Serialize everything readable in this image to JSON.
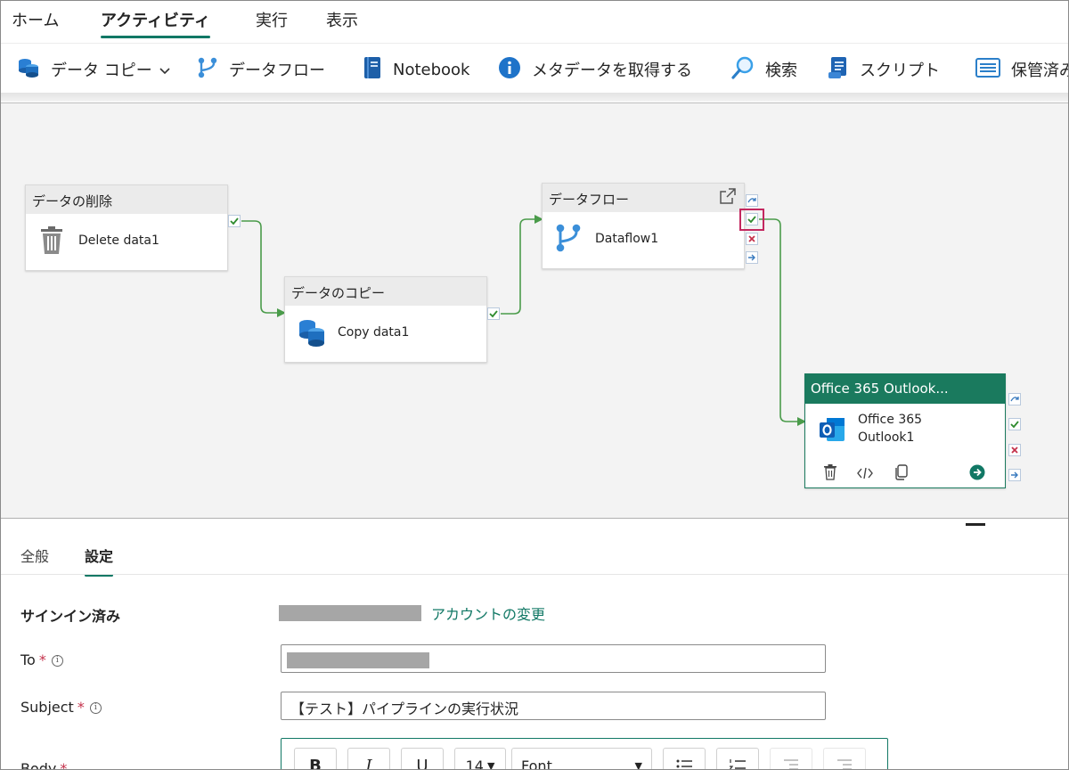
{
  "top_tabs": [
    {
      "label": "ホーム",
      "active": false
    },
    {
      "label": "アクティビティ",
      "active": true
    },
    {
      "label": "実行",
      "active": false
    },
    {
      "label": "表示",
      "active": false
    }
  ],
  "toolbar": {
    "copy_data": "データ コピー",
    "dataflow": "データフロー",
    "notebook": "Notebook",
    "get_metadata": "メタデータを取得する",
    "lookup": "検索",
    "script": "スクリプト",
    "stored_proc": "保管済み"
  },
  "nodes": {
    "delete": {
      "header": "データの削除",
      "label": "Delete data1",
      "icon": "trash-icon"
    },
    "copy": {
      "header": "データのコピー",
      "label": "Copy data1",
      "icon": "database-copy-icon"
    },
    "dataflow": {
      "header": "データフロー",
      "label": "Dataflow1",
      "icon": "dataflow-icon"
    },
    "outlook": {
      "header": "Office 365 Outlook...",
      "label_line1": "Office 365",
      "label_line2": "Outlook1",
      "icon": "outlook-icon"
    }
  },
  "colors": {
    "accent": "#117865",
    "wire": "#4a9b4a",
    "fail": "#c4314b",
    "highlight": "#c3275f",
    "outlook_header": "#1a7a5e"
  },
  "panel": {
    "tabs": [
      {
        "label": "全般",
        "active": false
      },
      {
        "label": "設定",
        "active": true
      }
    ],
    "signed_in_label": "サインイン済み",
    "change_account": "アカウントの変更",
    "to_label": "To",
    "subject_label": "Subject",
    "subject_value": "【テスト】パイプラインの実行状況",
    "body_label": "Body",
    "required_mark": "*",
    "info_mark": "i",
    "rte": {
      "bold": "B",
      "italic": "I",
      "underline": "U",
      "font_size": "14",
      "font": "Font"
    }
  }
}
